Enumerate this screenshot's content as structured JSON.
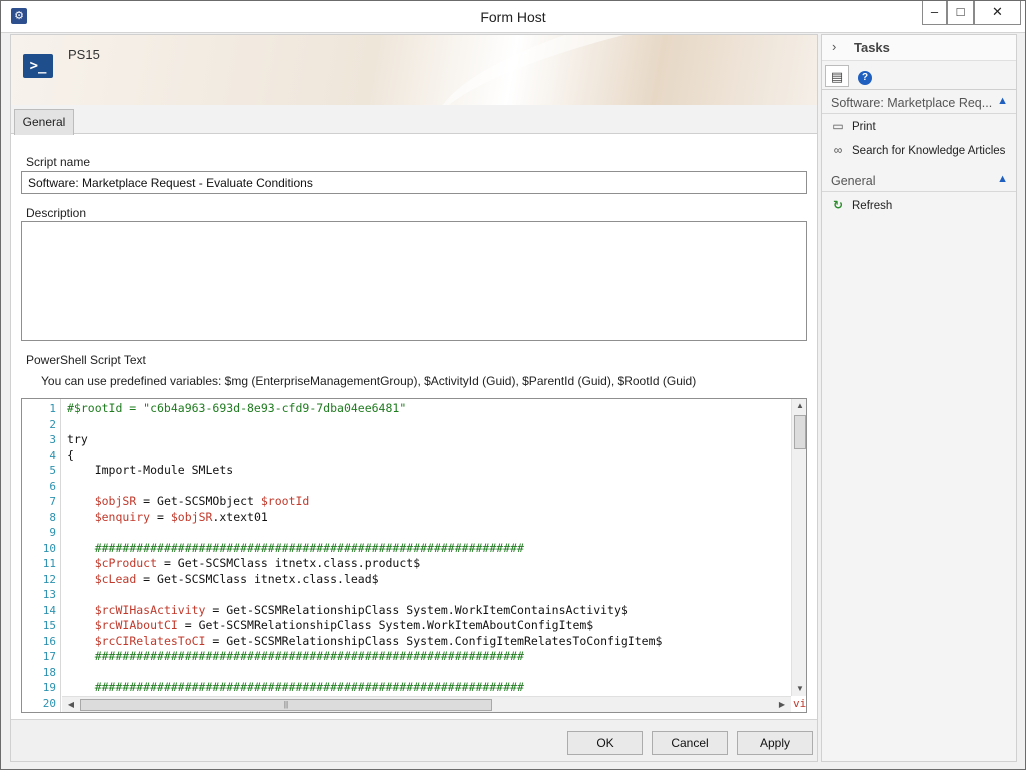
{
  "window": {
    "title": "Form Host",
    "controls": {
      "minimize": "‒",
      "maximize": "□",
      "close": "✕"
    }
  },
  "form": {
    "name": "PS15",
    "tabs": [
      {
        "label": "General"
      }
    ],
    "fields": {
      "script_name": {
        "label": "Script name",
        "value": "Software: Marketplace Request - Evaluate Conditions"
      },
      "description": {
        "label": "Description",
        "value": ""
      },
      "powershell": {
        "label": "PowerShell Script Text",
        "hint": "You can use predefined variables: $mg (EnterpriseManagementGroup), $ActivityId (Guid), $ParentId (Guid), $RootId (Guid)"
      }
    }
  },
  "code": {
    "lines": [
      {
        "n": "1",
        "indent": "",
        "segs": [
          {
            "c": "cm",
            "t": "#$rootId = \"c6b4a963-693d-8e93-cfd9-7dba04ee6481\""
          }
        ]
      },
      {
        "n": "2",
        "indent": "",
        "segs": []
      },
      {
        "n": "3",
        "indent": "",
        "segs": [
          {
            "c": "",
            "t": "try"
          }
        ]
      },
      {
        "n": "4",
        "indent": "",
        "segs": [
          {
            "c": "",
            "t": "{"
          }
        ]
      },
      {
        "n": "5",
        "indent": "    ",
        "segs": [
          {
            "c": "",
            "t": "Import-Module SMLets"
          }
        ]
      },
      {
        "n": "6",
        "indent": "",
        "segs": []
      },
      {
        "n": "7",
        "indent": "    ",
        "segs": [
          {
            "c": "vr",
            "t": "$objSR"
          },
          {
            "c": "",
            "t": " = Get-SCSMObject "
          },
          {
            "c": "vr",
            "t": "$rootId"
          }
        ]
      },
      {
        "n": "8",
        "indent": "    ",
        "segs": [
          {
            "c": "vr",
            "t": "$enquiry"
          },
          {
            "c": "",
            "t": " = "
          },
          {
            "c": "vr",
            "t": "$objSR"
          },
          {
            "c": "",
            "t": ".xtext01"
          }
        ]
      },
      {
        "n": "9",
        "indent": "",
        "segs": []
      },
      {
        "n": "10",
        "indent": "    ",
        "segs": [
          {
            "c": "cm",
            "t": "##############################################################"
          }
        ]
      },
      {
        "n": "11",
        "indent": "    ",
        "segs": [
          {
            "c": "vr",
            "t": "$cProduct"
          },
          {
            "c": "",
            "t": " = Get-SCSMClass itnetx.class.product$"
          }
        ]
      },
      {
        "n": "12",
        "indent": "    ",
        "segs": [
          {
            "c": "vr",
            "t": "$cLead"
          },
          {
            "c": "",
            "t": " = Get-SCSMClass itnetx.class.lead$"
          }
        ]
      },
      {
        "n": "13",
        "indent": "",
        "segs": []
      },
      {
        "n": "14",
        "indent": "    ",
        "segs": [
          {
            "c": "vr",
            "t": "$rcWIHasActivity"
          },
          {
            "c": "",
            "t": " = Get-SCSMRelationshipClass System.WorkItemContainsActivity$"
          }
        ]
      },
      {
        "n": "15",
        "indent": "    ",
        "segs": [
          {
            "c": "vr",
            "t": "$rcWIAboutCI"
          },
          {
            "c": "",
            "t": " = Get-SCSMRelationshipClass System.WorkItemAboutConfigItem$"
          }
        ]
      },
      {
        "n": "16",
        "indent": "    ",
        "segs": [
          {
            "c": "vr",
            "t": "$rcCIRelatesToCI"
          },
          {
            "c": "",
            "t": " = Get-SCSMRelationshipClass System.ConfigItemRelatesToConfigItem$"
          }
        ]
      },
      {
        "n": "17",
        "indent": "    ",
        "segs": [
          {
            "c": "cm",
            "t": "##############################################################"
          }
        ]
      },
      {
        "n": "18",
        "indent": "",
        "segs": []
      },
      {
        "n": "19",
        "indent": "    ",
        "segs": [
          {
            "c": "cm",
            "t": "##############################################################"
          }
        ]
      },
      {
        "n": "20",
        "indent": "",
        "segs": []
      }
    ],
    "overflow_text": "vi",
    "scroll_glyphs": {
      "up": "▲",
      "down": "▼",
      "left": "◀",
      "right": "▶",
      "grip": "||"
    }
  },
  "footer": {
    "ok": "OK",
    "cancel": "Cancel",
    "apply": "Apply"
  },
  "tasks": {
    "title": "Tasks",
    "collapse_glyph": "›",
    "tab_icons": [
      "clipboard-icon",
      "help-icon"
    ],
    "sections": [
      {
        "title": "Software: Marketplace Req...",
        "items": [
          {
            "label": "Print",
            "icon": "printer-icon"
          },
          {
            "label": "Search for Knowledge Articles",
            "icon": "link-icon"
          }
        ]
      },
      {
        "title": "General",
        "items": [
          {
            "label": "Refresh",
            "icon": "refresh-icon"
          }
        ]
      }
    ]
  }
}
